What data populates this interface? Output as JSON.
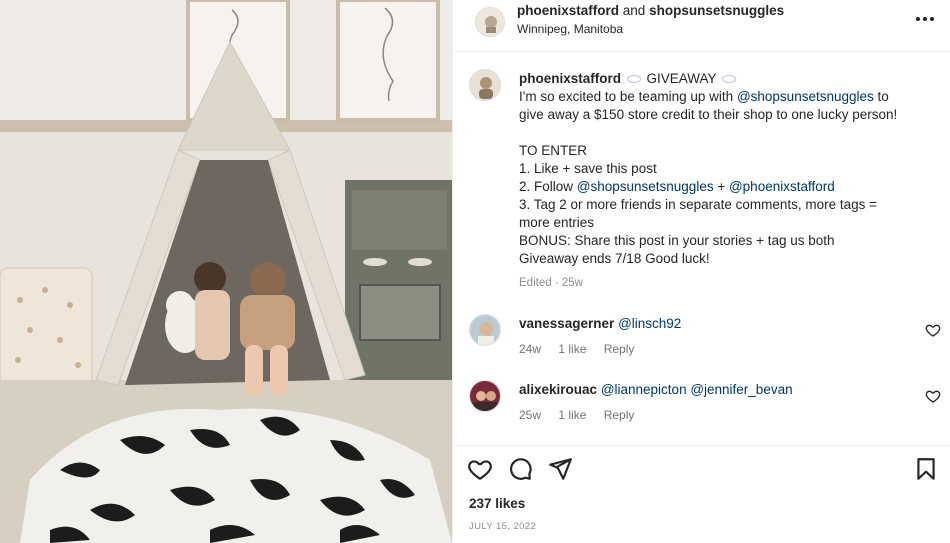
{
  "post": {
    "author": "phoenixstafford",
    "joiner": "and",
    "collab": "shopsunsetsnuggles",
    "location": "Winnipeg, Manitoba"
  },
  "caption": {
    "username": "phoenixstafford",
    "tag": "GIVEAWAY",
    "line1_pre": "I'm so excited to be teaming up with ",
    "line1_mention": "@shopsunsetsnuggles",
    "line1_post": " to",
    "line2": "give away a $150 store credit to their shop to one lucky person!",
    "to_enter": "TO ENTER",
    "step1": "1. Like + save this post",
    "step2_pre": "2. Follow ",
    "step2_mention1": "@shopsunsetsnuggles",
    "step2_sep": " + ",
    "step2_mention2": "@phoenixstafford",
    "step3a": "3. Tag 2 or more friends in separate comments, more tags =",
    "step3b": "more entries",
    "bonus": "BONUS: Share this post in your stories + tag us both",
    "ends": "Giveaway ends 7/18 Good luck!",
    "edited": "Edited",
    "dot": "·",
    "age": "25w"
  },
  "comments": [
    {
      "username": "vanessagerner",
      "mentions": "@linsch92",
      "age": "24w",
      "likes": "1 like",
      "reply": "Reply"
    },
    {
      "username": "alixekirouac",
      "mentions": "@liannepicton @jennifer_bevan",
      "age": "25w",
      "likes": "1 like",
      "reply": "Reply"
    }
  ],
  "footer": {
    "likes": "237 likes",
    "date": "JULY 15, 2022"
  },
  "colors": {
    "mention": "#00376b",
    "muted": "#8e8e8e",
    "text": "#262626"
  },
  "icons": [
    "more-icon",
    "heart-icon",
    "comment-icon",
    "share-icon",
    "bookmark-icon",
    "comment-heart-icon"
  ]
}
